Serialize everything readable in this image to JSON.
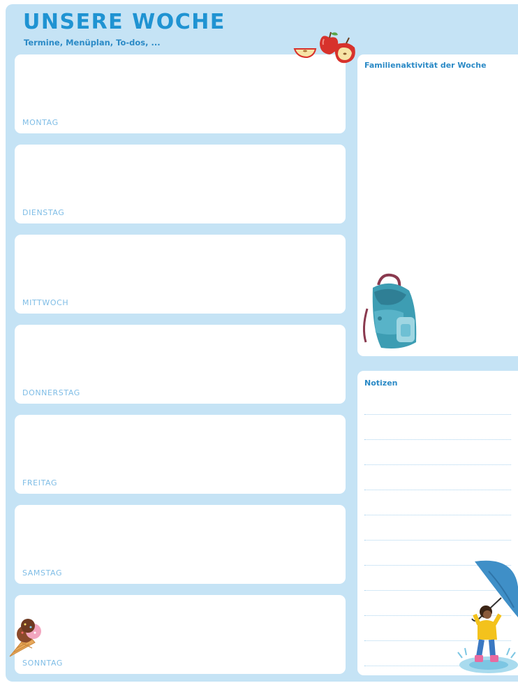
{
  "header": {
    "title": "UNSERE WOCHE",
    "subtitle": "Termine, Menüplan, To-dos, ..."
  },
  "days": [
    "MONTAG",
    "DIENSTAG",
    "MITTWOCH",
    "DONNERSTAG",
    "FREITAG",
    "SAMSTAG",
    "SONNTAG"
  ],
  "activity": {
    "heading": "Familienaktivität der Woche"
  },
  "notes": {
    "heading": "Notizen",
    "line_count": 12
  },
  "colors": {
    "background": "#c5e3f5",
    "title": "#1f93d2",
    "day_label": "#7fbde6",
    "panel": "#ffffff"
  },
  "illustrations": [
    "apple-illustration",
    "backpack-illustration",
    "ice-cream-illustration",
    "child-with-umbrella-illustration"
  ]
}
